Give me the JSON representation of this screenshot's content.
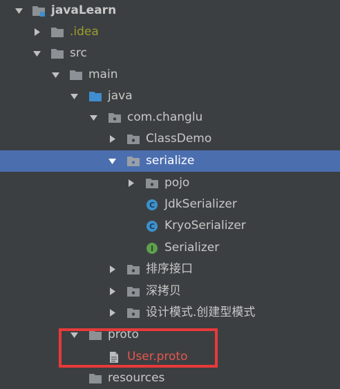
{
  "project_tree": {
    "root": {
      "label": "javaLearn"
    },
    "idea": {
      "label": ".idea"
    },
    "src": {
      "label": "src"
    },
    "main": {
      "label": "main"
    },
    "java": {
      "label": "java"
    },
    "com_changlu": {
      "label": "com.changlu"
    },
    "classdemo": {
      "label": "ClassDemo"
    },
    "serialize": {
      "label": "serialize"
    },
    "pojo": {
      "label": "pojo"
    },
    "jdk_serializer": {
      "label": "JdkSerializer",
      "badge": "C"
    },
    "kryo_serializer": {
      "label": "KryoSerializer",
      "badge": "C"
    },
    "serializer": {
      "label": "Serializer",
      "badge": "I"
    },
    "sort_interface": {
      "label": "排序接口"
    },
    "deep_copy": {
      "label": "深拷贝"
    },
    "design_patterns": {
      "label": "设计模式.创建型模式"
    },
    "proto": {
      "label": "proto"
    },
    "user_proto": {
      "label": "User.proto"
    },
    "resources": {
      "label": "resources"
    }
  },
  "colors": {
    "background": "#3c3f41",
    "selection": "#4b6eaf",
    "folder": "#8c9196",
    "source_folder": "#3e8ed0",
    "class_badge": "#3d91cc",
    "interface_badge": "#5fa04e",
    "error_text": "#e6574f",
    "highlight_box": "#e8393a"
  }
}
